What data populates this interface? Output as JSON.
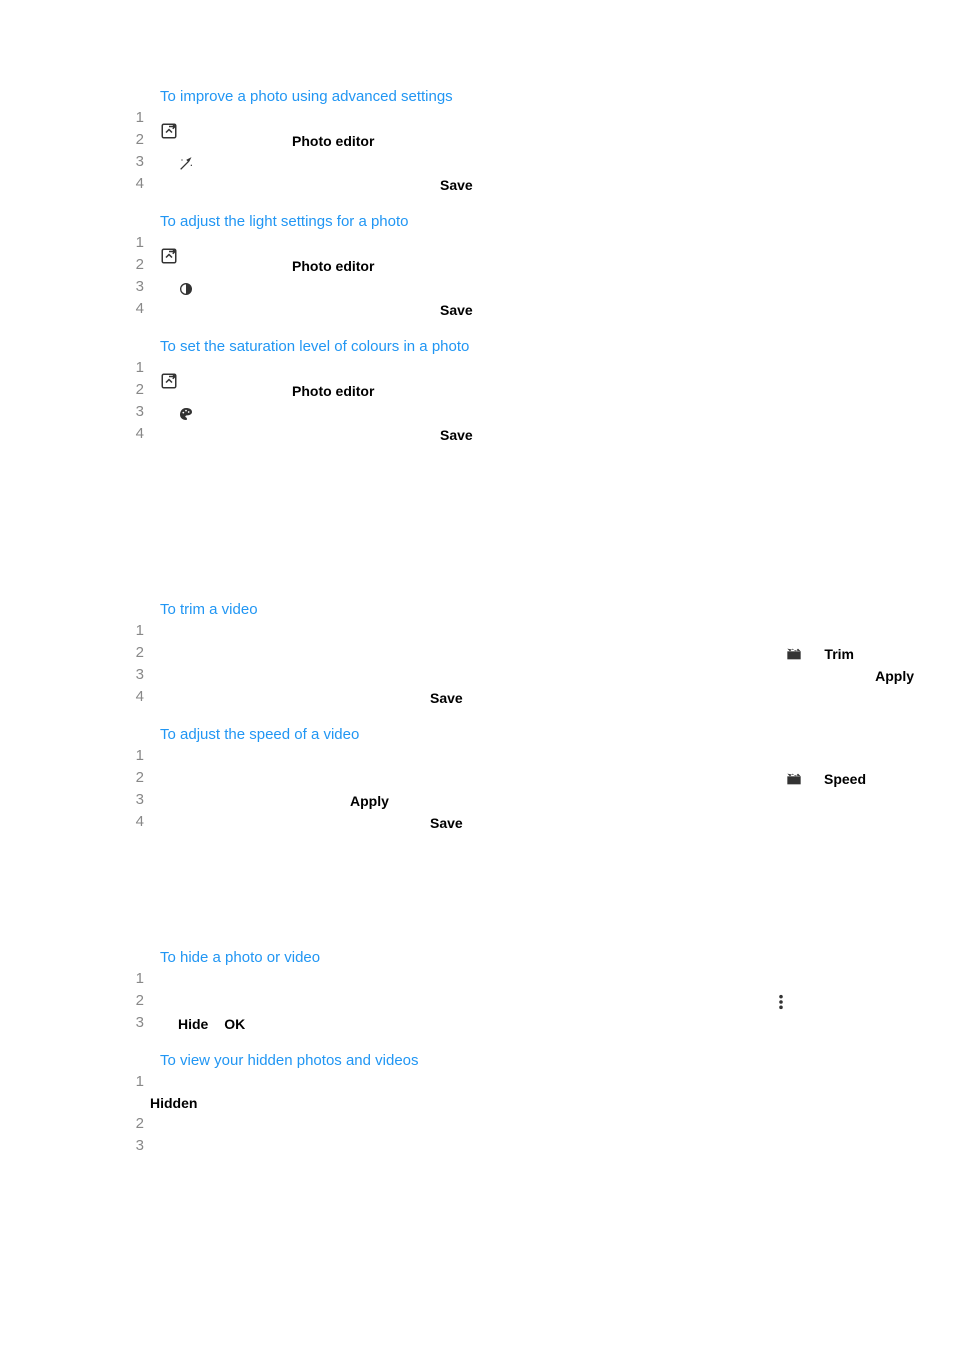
{
  "sections": {
    "advanced": {
      "title": "To improve a photo using advanced settings",
      "photo_editor": "Photo editor",
      "save": "Save"
    },
    "light": {
      "title": "To adjust the light settings for a photo",
      "photo_editor": "Photo editor",
      "save": "Save"
    },
    "saturation": {
      "title": "To set the saturation level of colours in a photo",
      "photo_editor": "Photo editor",
      "save": "Save"
    },
    "trim": {
      "title": "To trim a video",
      "trim": "Trim",
      "apply": "Apply",
      "save": "Save"
    },
    "speed": {
      "title": "To adjust the speed of a video",
      "speed": "Speed",
      "apply": "Apply",
      "save": "Save"
    },
    "hide": {
      "title": "To hide a photo or video",
      "hide": "Hide",
      "ok": "OK"
    },
    "viewhidden": {
      "title": "To view your hidden photos and videos",
      "hidden": "Hidden"
    }
  }
}
